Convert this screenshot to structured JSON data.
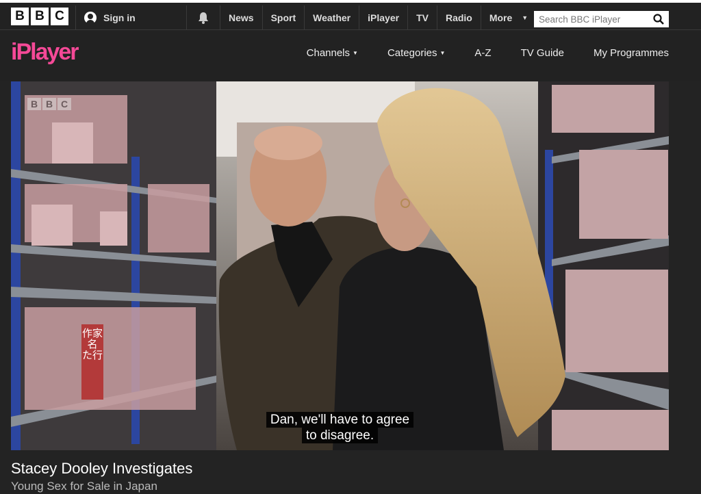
{
  "bbc_logo": [
    "B",
    "B",
    "C"
  ],
  "header": {
    "sign_in": "Sign in",
    "nav": [
      "News",
      "Sport",
      "Weather",
      "iPlayer",
      "TV",
      "Radio",
      "More"
    ],
    "search_placeholder": "Search BBC iPlayer"
  },
  "iplayer": {
    "logo": "iPlayer",
    "subnav": [
      {
        "label": "Channels",
        "dropdown": true
      },
      {
        "label": "Categories",
        "dropdown": true
      },
      {
        "label": "A-Z",
        "dropdown": false
      },
      {
        "label": "TV Guide",
        "dropdown": false
      },
      {
        "label": "My Programmes",
        "dropdown": false
      }
    ]
  },
  "video": {
    "watermark": [
      "B",
      "B",
      "C"
    ],
    "subtitles": [
      "Dan, we'll have to agree",
      "to disagree."
    ],
    "shelf_sign": "作家名 た行"
  },
  "programme": {
    "title": "Stacey Dooley Investigates",
    "episode": "Young Sex for Sale in Japan"
  },
  "colors": {
    "brand_pink": "#f54997",
    "background": "#232323"
  }
}
